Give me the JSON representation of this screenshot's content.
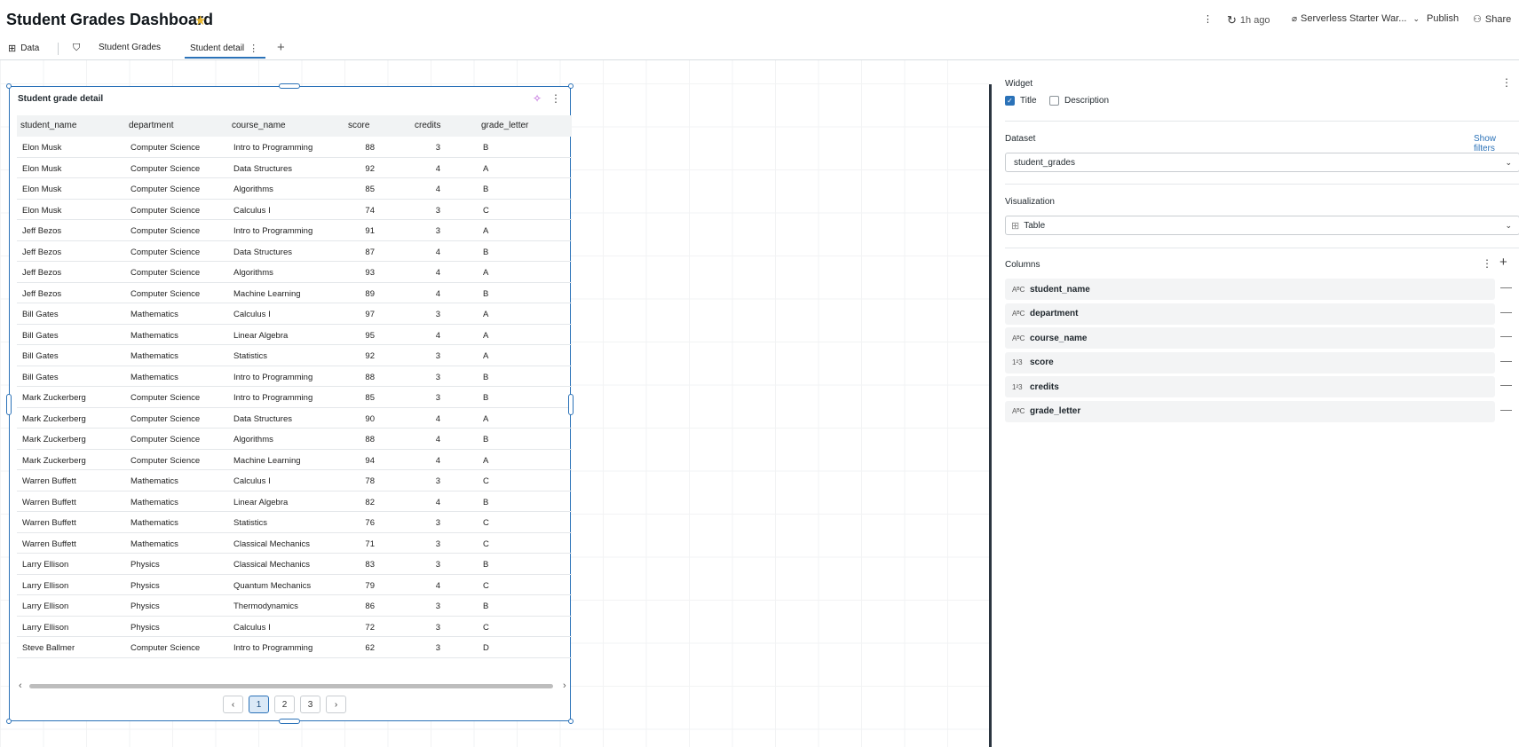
{
  "header": {
    "title": "Student Grades Dashboard",
    "refresh_time": "1h ago",
    "warehouse": "Serverless Starter War...",
    "publish_label": "Publish",
    "share_label": "Share"
  },
  "tabs": {
    "data_label": "Data",
    "pages": [
      "Student Grades",
      "Student detail"
    ],
    "active": "Student detail"
  },
  "widget": {
    "title": "Student grade detail",
    "columns": [
      "student_name",
      "department",
      "course_name",
      "score",
      "credits",
      "grade_letter"
    ],
    "rows": [
      [
        "Elon Musk",
        "Computer Science",
        "Intro to Programming",
        "88",
        "3",
        "B"
      ],
      [
        "Elon Musk",
        "Computer Science",
        "Data Structures",
        "92",
        "4",
        "A"
      ],
      [
        "Elon Musk",
        "Computer Science",
        "Algorithms",
        "85",
        "4",
        "B"
      ],
      [
        "Elon Musk",
        "Computer Science",
        "Calculus I",
        "74",
        "3",
        "C"
      ],
      [
        "Jeff Bezos",
        "Computer Science",
        "Intro to Programming",
        "91",
        "3",
        "A"
      ],
      [
        "Jeff Bezos",
        "Computer Science",
        "Data Structures",
        "87",
        "4",
        "B"
      ],
      [
        "Jeff Bezos",
        "Computer Science",
        "Algorithms",
        "93",
        "4",
        "A"
      ],
      [
        "Jeff Bezos",
        "Computer Science",
        "Machine Learning",
        "89",
        "4",
        "B"
      ],
      [
        "Bill Gates",
        "Mathematics",
        "Calculus I",
        "97",
        "3",
        "A"
      ],
      [
        "Bill Gates",
        "Mathematics",
        "Linear Algebra",
        "95",
        "4",
        "A"
      ],
      [
        "Bill Gates",
        "Mathematics",
        "Statistics",
        "92",
        "3",
        "A"
      ],
      [
        "Bill Gates",
        "Mathematics",
        "Intro to Programming",
        "88",
        "3",
        "B"
      ],
      [
        "Mark Zuckerberg",
        "Computer Science",
        "Intro to Programming",
        "85",
        "3",
        "B"
      ],
      [
        "Mark Zuckerberg",
        "Computer Science",
        "Data Structures",
        "90",
        "4",
        "A"
      ],
      [
        "Mark Zuckerberg",
        "Computer Science",
        "Algorithms",
        "88",
        "4",
        "B"
      ],
      [
        "Mark Zuckerberg",
        "Computer Science",
        "Machine Learning",
        "94",
        "4",
        "A"
      ],
      [
        "Warren Buffett",
        "Mathematics",
        "Calculus I",
        "78",
        "3",
        "C"
      ],
      [
        "Warren Buffett",
        "Mathematics",
        "Linear Algebra",
        "82",
        "4",
        "B"
      ],
      [
        "Warren Buffett",
        "Mathematics",
        "Statistics",
        "76",
        "3",
        "C"
      ],
      [
        "Warren Buffett",
        "Mathematics",
        "Classical Mechanics",
        "71",
        "3",
        "C"
      ],
      [
        "Larry Ellison",
        "Physics",
        "Classical Mechanics",
        "83",
        "3",
        "B"
      ],
      [
        "Larry Ellison",
        "Physics",
        "Quantum Mechanics",
        "79",
        "4",
        "C"
      ],
      [
        "Larry Ellison",
        "Physics",
        "Thermodynamics",
        "86",
        "3",
        "B"
      ],
      [
        "Larry Ellison",
        "Physics",
        "Calculus I",
        "72",
        "3",
        "C"
      ],
      [
        "Steve Ballmer",
        "Computer Science",
        "Intro to Programming",
        "62",
        "3",
        "D"
      ]
    ],
    "pages": [
      "1",
      "2",
      "3"
    ],
    "current_page": "1"
  },
  "panel": {
    "widget_label": "Widget",
    "title_option": "Title",
    "title_checked": true,
    "description_option": "Description",
    "description_checked": false,
    "dataset_label": "Dataset",
    "show_filters_label": "Show filters",
    "dataset_value": "student_grades",
    "visualization_label": "Visualization",
    "visualization_value": "Table",
    "columns_label": "Columns",
    "columns": [
      {
        "name": "student_name",
        "type_icon": "string-type-icon"
      },
      {
        "name": "department",
        "type_icon": "string-type-icon"
      },
      {
        "name": "course_name",
        "type_icon": "string-type-icon"
      },
      {
        "name": "score",
        "type_icon": "number-type-icon"
      },
      {
        "name": "credits",
        "type_icon": "number-type-icon"
      },
      {
        "name": "grade_letter",
        "type_icon": "string-type-icon"
      }
    ]
  },
  "colors": {
    "accent": "#2b72b8",
    "star": "#e8b731",
    "ai_sparkle": "#b44fd6"
  }
}
